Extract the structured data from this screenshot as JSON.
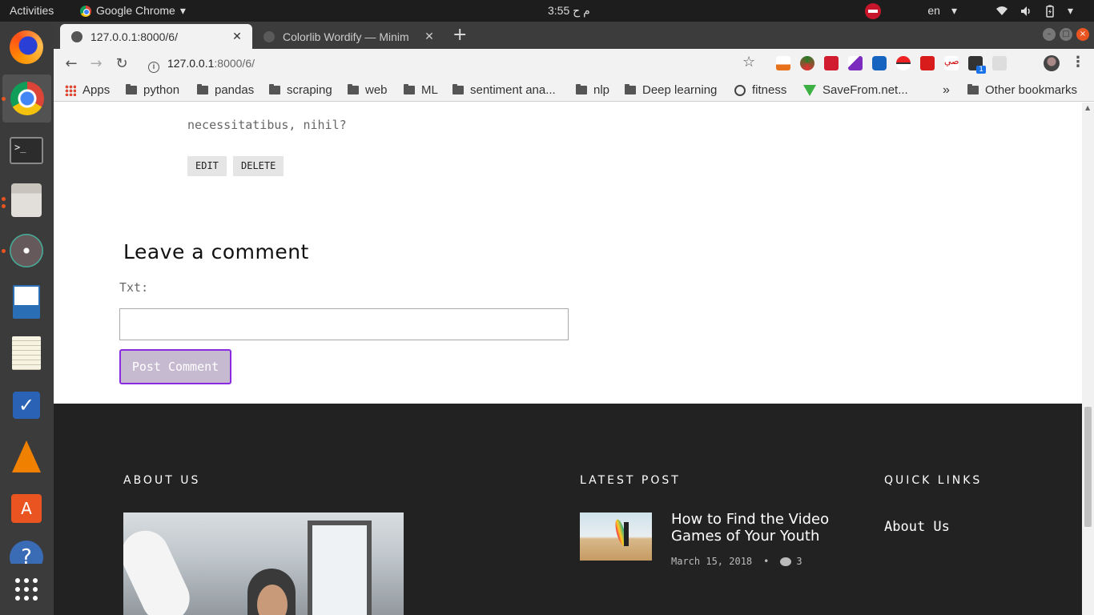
{
  "topbar": {
    "activities": "Activities",
    "app_name": "Google Chrome",
    "app_arrow": "▾",
    "clock": "3:55 م ح",
    "lang": "en",
    "lang_arrow": "▾",
    "power_arrow": "▾"
  },
  "dock": {
    "apps": [
      "Firefox",
      "Google Chrome",
      "Terminal",
      "Files",
      "Atom",
      "LibreOffice Writer",
      "Text Editor",
      "Tasks",
      "VLC",
      "Ubuntu Software",
      "Help"
    ]
  },
  "tabs": [
    {
      "title": "127.0.0.1:8000/6/",
      "close": "✕"
    },
    {
      "title": "Colorlib Wordify — Minim",
      "close": "✕"
    }
  ],
  "new_tab": "+",
  "toolbar": {
    "back": "←",
    "forward": "→",
    "reload": "↻",
    "url_host": "127.0.0.1",
    "url_rest": ":8000/6/",
    "info_icon": "i",
    "star": "☆",
    "menu": "⋮",
    "ext_badge": "1"
  },
  "bookmarks": {
    "apps": "Apps",
    "items": [
      "python",
      "pandas",
      "scraping",
      "web",
      "ML",
      "sentiment ana...",
      "nlp",
      "Deep learning",
      "fitness",
      "SaveFrom.net..."
    ],
    "more": "»",
    "other": "Other bookmarks"
  },
  "post": {
    "partial_text": "",
    "text": "necessitatibus, nihil?",
    "edit_label": "EDIT",
    "delete_label": "DELETE"
  },
  "comment_form": {
    "heading": "Leave a comment",
    "label": "Txt:",
    "textarea_value": "",
    "submit_label": "Post Comment"
  },
  "footer": {
    "about_heading": "ABOUT US",
    "latest_heading": "LATEST POST",
    "quick_heading": "QUICK LINKS",
    "latest_post": {
      "title": "How to Find the Video Games of Your Youth",
      "date": "March 15, 2018",
      "separator": "•",
      "comments": "3"
    },
    "quick_links": [
      "About Us"
    ]
  },
  "colors": {
    "accent_purple": "#8a2be2",
    "button_fill": "#c6bad1",
    "footer_bg": "#222222",
    "ubuntu_orange": "#e95420"
  }
}
